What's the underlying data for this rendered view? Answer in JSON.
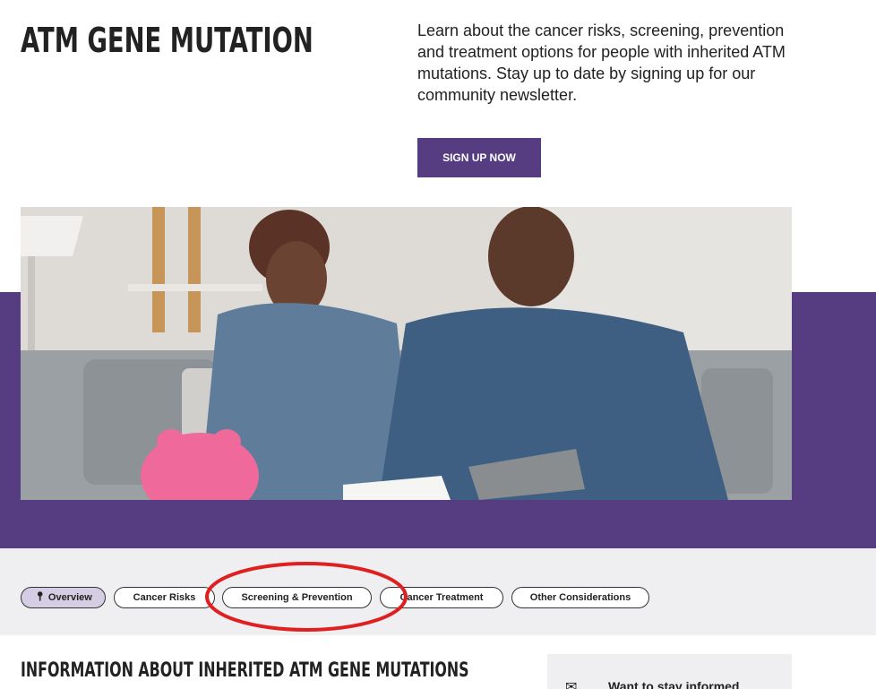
{
  "header": {
    "title": "ATM GENE MUTATION",
    "intro": "Learn about the cancer risks, screening, prevention and treatment options for people with inherited ATM mutations. Stay up to date by signing up for our community newsletter.",
    "signup_label": "SIGN UP NOW"
  },
  "hero": {
    "image_icon": "photo-couple-reviewing-finances"
  },
  "tabs": [
    {
      "label": "Overview",
      "icon": "pin-icon",
      "active": true
    },
    {
      "label": "Cancer Risks",
      "active": false
    },
    {
      "label": "Screening & Prevention",
      "active": false,
      "highlighted": true
    },
    {
      "label": "Cancer Treatment",
      "active": false
    },
    {
      "label": "Other Considerations",
      "active": false
    }
  ],
  "main": {
    "section_heading": "INFORMATION ABOUT INHERITED ATM GENE MUTATIONS"
  },
  "sidebar": {
    "card_icon": "envelope-signal-icon",
    "card_text": "Want to stay informed"
  },
  "colors": {
    "brand_purple": "#563d82",
    "active_tab": "#d4cde3",
    "tab_bar_bg": "#efeff1",
    "highlight_red": "#e02020"
  }
}
